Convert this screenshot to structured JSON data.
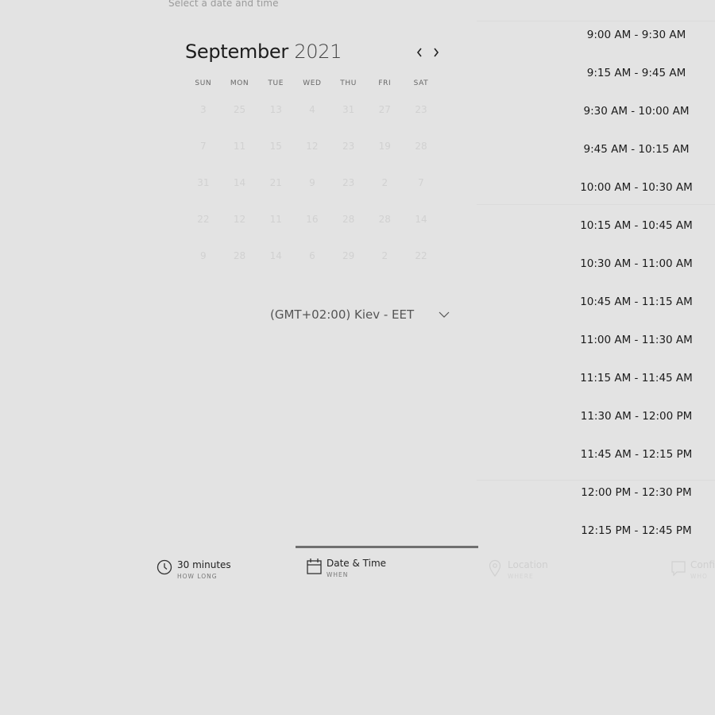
{
  "header": {
    "hint": "Select a date and time"
  },
  "calendar": {
    "month": "September",
    "year": "2021",
    "weekdays": [
      "SUN",
      "MON",
      "TUE",
      "WED",
      "THU",
      "FRI",
      "SAT"
    ],
    "days": [
      [
        "3",
        "25",
        "13",
        "4",
        "31",
        "27",
        "23"
      ],
      [
        "7",
        "11",
        "15",
        "12",
        "23",
        "19",
        "28"
      ],
      [
        "31",
        "14",
        "21",
        "9",
        "23",
        "2",
        "7"
      ],
      [
        "22",
        "12",
        "11",
        "16",
        "28",
        "28",
        "14"
      ],
      [
        "9",
        "28",
        "14",
        "6",
        "29",
        "2",
        "22"
      ]
    ]
  },
  "timezone": {
    "label": "(GMT+02:00) Kiev - EET"
  },
  "slots": [
    "9:00 AM - 9:30 AM",
    "9:15 AM - 9:45 AM",
    "9:30 AM - 10:00 AM",
    "9:45 AM - 10:15 AM",
    "10:00 AM - 10:30 AM",
    "10:15 AM - 10:45 AM",
    "10:30 AM - 11:00 AM",
    "10:45 AM - 11:15 AM",
    "11:00 AM - 11:30 AM",
    "11:15 AM - 11:45 AM",
    "11:30 AM - 12:00 PM",
    "11:45 AM - 12:15 PM",
    "12:00 PM - 12:30 PM",
    "12:15 PM - 12:45 PM"
  ],
  "steps": {
    "duration": {
      "label": "30 minutes",
      "sub": "HOW LONG",
      "icon": "clock-icon"
    },
    "datetime": {
      "label": "Date & Time",
      "sub": "WHEN",
      "icon": "calendar-icon"
    },
    "location": {
      "label": "Location",
      "sub": "WHERE",
      "icon": "location-pin-icon"
    },
    "confirm": {
      "label": "Confi",
      "sub": "WHO",
      "icon": "confirm-icon"
    }
  }
}
